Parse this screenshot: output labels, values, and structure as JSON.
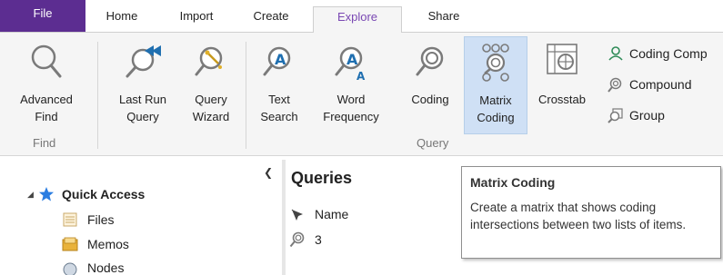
{
  "tabs": {
    "file": "File",
    "home": "Home",
    "import": "Import",
    "create": "Create",
    "explore": "Explore",
    "share": "Share"
  },
  "ribbon": {
    "advanced_find": {
      "line1": "Advanced",
      "line2": "Find"
    },
    "group_find": "Find",
    "last_run_query": {
      "line1": "Last Run",
      "line2": "Query"
    },
    "query_wizard": {
      "line1": "Query",
      "line2": "Wizard"
    },
    "text_search": {
      "line1": "Text",
      "line2": "Search"
    },
    "word_frequency": {
      "line1": "Word",
      "line2": "Frequency"
    },
    "coding": {
      "line1": "Coding",
      "line2": ""
    },
    "matrix_coding": {
      "line1": "Matrix",
      "line2": "Coding"
    },
    "crosstab": {
      "line1": "Crosstab",
      "line2": ""
    },
    "group_query": "Query",
    "small": {
      "coding_comparison": "Coding Comp",
      "compound": "Compound",
      "group": "Group"
    }
  },
  "nav": {
    "quick_access": "Quick Access",
    "files": "Files",
    "memos": "Memos",
    "nodes": "Nodes"
  },
  "list": {
    "title": "Queries",
    "column_name": "Name",
    "rows": [
      "3"
    ]
  },
  "tooltip": {
    "title": "Matrix  Coding",
    "body": "Create a matrix that shows coding intersections between two lists of items."
  },
  "colors": {
    "file_tab": "#5c2d91",
    "explore_tab_text": "#7a48b3",
    "ribbon_bg": "#f5f5f5",
    "selected_bg": "#cfe0f5",
    "icon_blue": "#1f6fb0",
    "star": "#2a7de1"
  }
}
